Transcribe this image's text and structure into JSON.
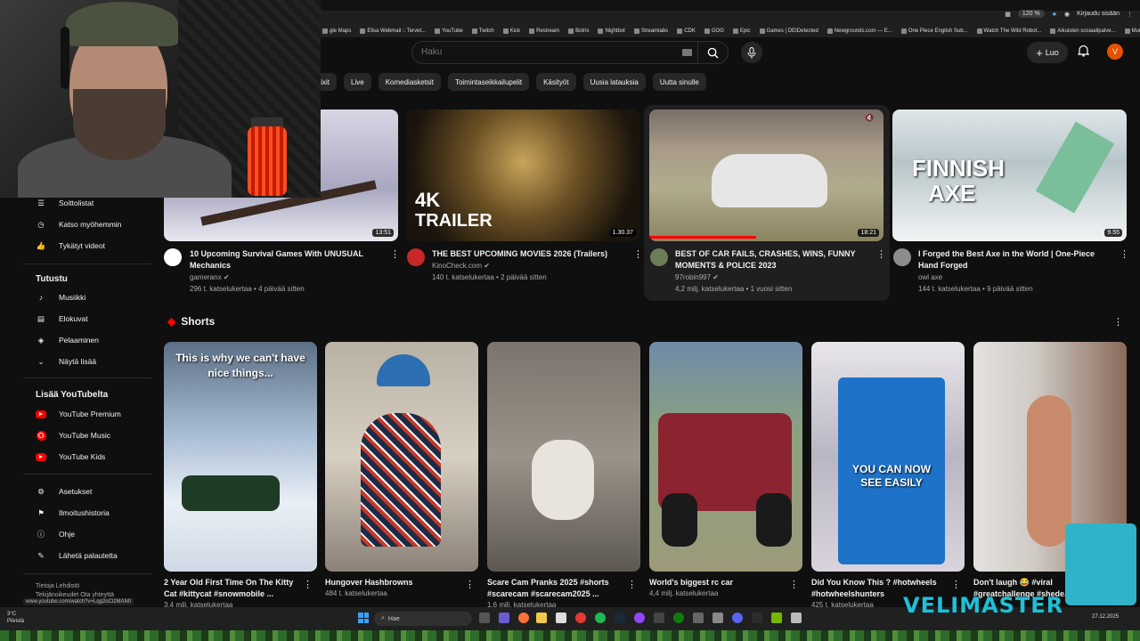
{
  "browser": {
    "zoom": "120 %",
    "signin": "Kirjaudu sisään",
    "bookmarks": [
      "gle Maps",
      "Elisa Webmail :: Tervet...",
      "YouTube",
      "Twitch",
      "Kick",
      "Restream",
      "Botrix",
      "Nightbot",
      "Streamlabs",
      "CDK",
      "GOG",
      "Epic",
      "Games | DEIDetected",
      "Newgrounds.com — E...",
      "One Piece English Sub...",
      "Watch The Wild Robot...",
      "Aikuisten sosiaalipalve...",
      "Muut kirjanmerkit"
    ]
  },
  "header": {
    "search_placeholder": "Haku",
    "create_label": "Luo",
    "avatar_letter": "V"
  },
  "chips": [
    "Mixit",
    "Live",
    "Komediasketsit",
    "Toimintaseikkailupelit",
    "Käsityöt",
    "Uusia latauksia",
    "Uutta sinulle"
  ],
  "sidebar": {
    "items_top": [
      {
        "label": "Soittolistat",
        "icon": "playlist-icon"
      },
      {
        "label": "Katso myöhemmin",
        "icon": "clock-icon"
      },
      {
        "label": "Tykätyt videot",
        "icon": "thumbs-up-icon"
      }
    ],
    "explore_title": "Tutustu",
    "explore": [
      {
        "label": "Musiikki",
        "icon": "music-note-icon"
      },
      {
        "label": "Elokuvat",
        "icon": "film-icon"
      },
      {
        "label": "Pelaaminen",
        "icon": "gamepad-icon"
      },
      {
        "label": "Näytä lisää",
        "icon": "chevron-down-icon"
      }
    ],
    "more_title": "Lisää YouTubelta",
    "more": [
      {
        "label": "YouTube Premium"
      },
      {
        "label": "YouTube Music"
      },
      {
        "label": "YouTube Kids"
      }
    ],
    "settings": [
      {
        "label": "Asetukset",
        "icon": "gear-icon"
      },
      {
        "label": "Ilmoitushistoria",
        "icon": "flag-icon"
      },
      {
        "label": "Ohje",
        "icon": "help-icon"
      },
      {
        "label": "Lähetä palautetta",
        "icon": "feedback-icon"
      }
    ],
    "footer1": "Tietoja  Lehdistö",
    "footer2": "Tekijänoikeudet  Ota yhteyttä"
  },
  "videos": [
    {
      "title": "10 Upcoming Survival Games With UNUSUAL Mechanics",
      "channel": "gameranx",
      "meta": "296 t. katselukertaa • 4 päivää sitten",
      "duration": "13:51",
      "verified": true
    },
    {
      "title": "THE BEST UPCOMING MOVIES 2026 (Trailers)",
      "channel": "KinoCheck.com",
      "meta": "140 t. katselukertaa • 2 päivää sitten",
      "duration": "1.30.37",
      "verified": true,
      "thumb_text1": "4K",
      "thumb_text2": "TRAILER"
    },
    {
      "title": "BEST OF CAR FAILS, CRASHES, WINS, FUNNY MOMENTS & POLICE 2023",
      "channel": "97robin997",
      "meta": "4,2 milj. katselukertaa • 1 vuosi sitten",
      "duration": "18:21",
      "verified": true
    },
    {
      "title": "I Forged the Best Axe in the World | One-Piece Hand Forged",
      "channel": "owl axe",
      "meta": "144 t. katselukertaa • 9 päivää sitten",
      "duration": "9.55",
      "verified": false,
      "thumb_text1": "FINNISH",
      "thumb_text2": "AXE"
    }
  ],
  "shorts_title": "Shorts",
  "shorts": [
    {
      "title": "2 Year Old First Time On The Kitty Cat #kittycat #snowmobile ...",
      "meta": "3,4 milj. katselukertaa",
      "overlay": "This is why we can't have nice things..."
    },
    {
      "title": "Hungover Hashbrowns",
      "meta": "484 t. katselukertaa"
    },
    {
      "title": "Scare Cam Pranks 2025 #shorts #scarecam #scarecam2025 ...",
      "meta": "1,6 milj. katselukertaa"
    },
    {
      "title": "World's biggest rc car",
      "meta": "4,4 milj. katselukertaa"
    },
    {
      "title": "Did You Know This ? #hotwheels #hotwheelshunters",
      "meta": "425 t. katselukertaa",
      "overlay": "YOU CAN NOW SEE EASILY"
    },
    {
      "title": "Don't laugh 😂 #viral #greatchallenge #shede...",
      "meta": ""
    }
  ],
  "status_url": "www.youtube.com/watch?v=Lqg2oCl2MAN0",
  "taskbar": {
    "search": "Hae",
    "weather": "3°C",
    "weather_desc": "Pilvistä",
    "date": "27.12.2025"
  },
  "watermark": "VELIMASTER"
}
